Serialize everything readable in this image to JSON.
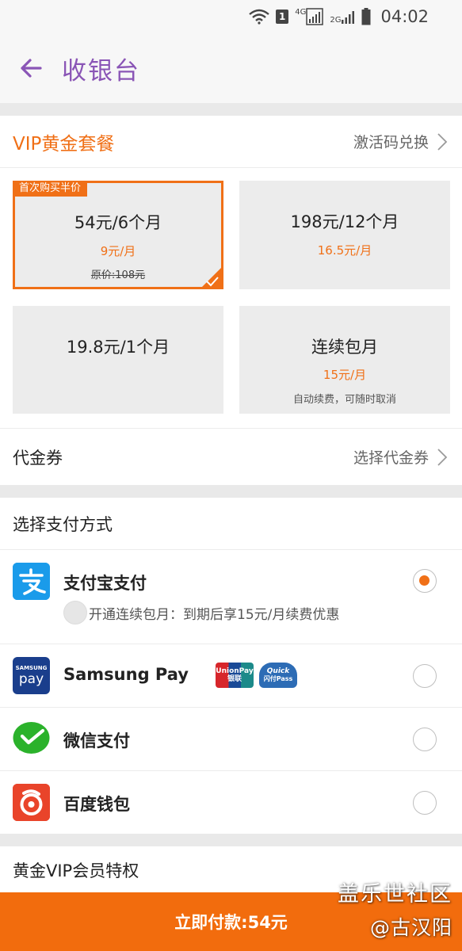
{
  "status_bar": {
    "badge": "1",
    "network_4g": "4G",
    "network_2g": "2G",
    "time": "04:02"
  },
  "header": {
    "title": "收银台",
    "back_icon": "arrow-left-icon",
    "accent_color": "#8a55b6"
  },
  "vip": {
    "title": "VIP黄金套餐",
    "activate_label": "激活码兑换",
    "accent_color": "#f07017",
    "plans": [
      {
        "price": "54元/6个月",
        "monthly": "9元/月",
        "original": "原价:108元",
        "promo_tag": "首次购买半价",
        "selected": true
      },
      {
        "price": "198元/12个月",
        "monthly": "16.5元/月",
        "selected": false
      },
      {
        "price": "19.8元/1个月",
        "selected": false
      },
      {
        "price": "连续包月",
        "monthly": "15元/月",
        "note": "自动续费，可随时取消",
        "selected": false
      }
    ]
  },
  "voucher": {
    "label": "代金券",
    "action": "选择代金券"
  },
  "payment": {
    "heading": "选择支付方式",
    "methods": [
      {
        "name": "支付宝支付",
        "icon": "alipay-icon",
        "selected": true,
        "sub_option": "开通连续包月：到期后享15元/月续费优惠"
      },
      {
        "name": "Samsung Pay",
        "icon": "samsung-pay-icon",
        "selected": false,
        "logo_text": "SAMSUNG",
        "logo_word": "pay",
        "card_logos": [
          "unionpay-icon",
          "quickpass-icon"
        ],
        "unionpay_text": "UnionPay",
        "unionpay_cn": "银联",
        "quickpass_text": "Quick",
        "quickpass_cn": "闪付Pass"
      },
      {
        "name": "微信支付",
        "icon": "wechat-pay-icon",
        "selected": false
      },
      {
        "name": "百度钱包",
        "icon": "baidu-wallet-icon",
        "selected": false
      }
    ]
  },
  "privileges": {
    "title": "黄金VIP会员特权"
  },
  "pay_button": {
    "label": "立即付款:54元"
  },
  "watermark": {
    "line1": "盖乐世社区",
    "line2": "@古汉阳"
  }
}
